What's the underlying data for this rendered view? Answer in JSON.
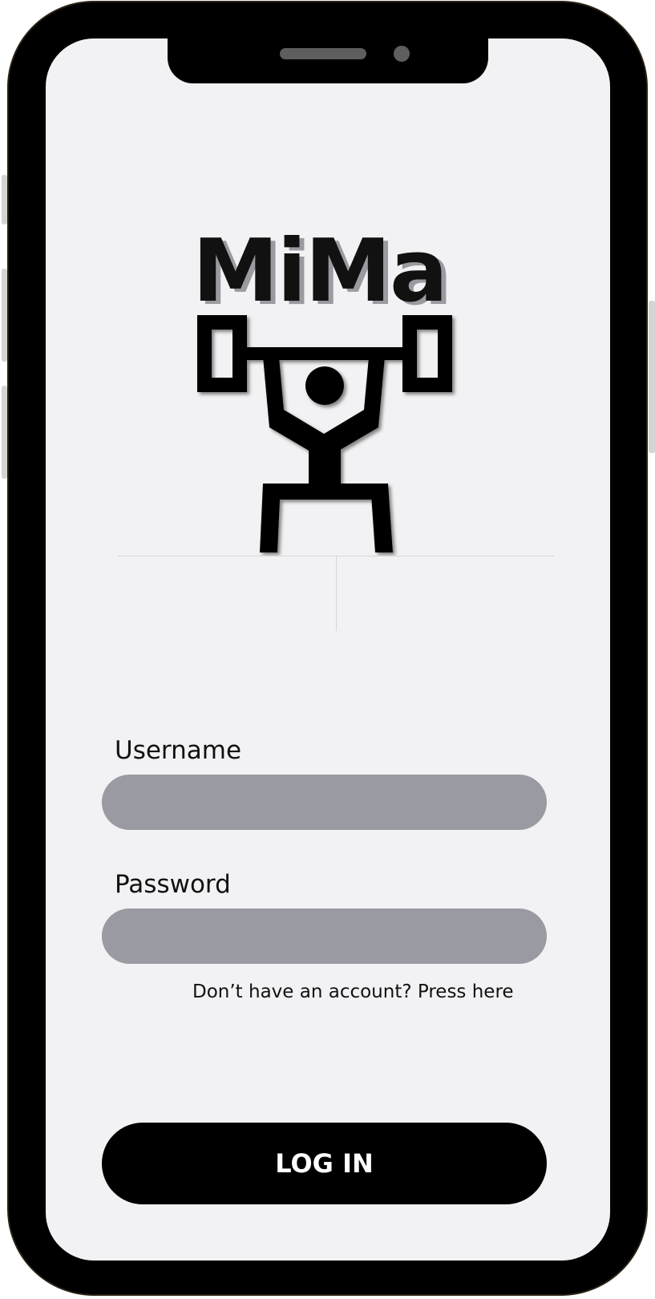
{
  "app": {
    "name": "MiMa"
  },
  "login_form": {
    "username_label": "Username",
    "username_value": "",
    "password_label": "Password",
    "password_value": "",
    "signup_text": "Don’t have an account? Press here",
    "login_button": "LOG IN"
  },
  "icons": {
    "logo": "weightlifter-icon"
  },
  "colors": {
    "screen_background": "#f2f2f4",
    "input_fill": "#9a9aa2",
    "button_fill": "#000000",
    "button_text": "#ffffff",
    "device_frame": "#000000"
  }
}
